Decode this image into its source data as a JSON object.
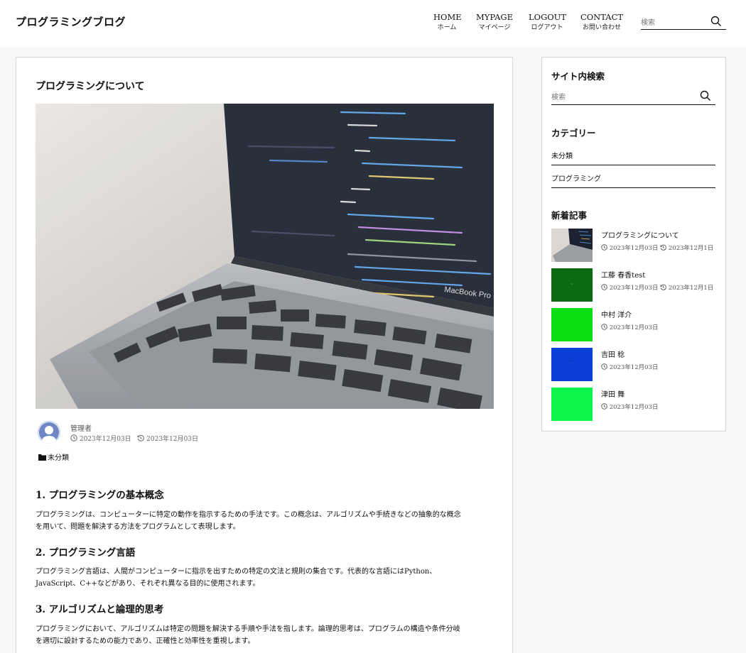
{
  "header": {
    "site_title": "プログラミングブログ",
    "nav": [
      {
        "en": "HOME",
        "jp": "ホーム"
      },
      {
        "en": "MYPAGE",
        "jp": "マイページ"
      },
      {
        "en": "LOGOUT",
        "jp": "ログアウト"
      },
      {
        "en": "CONTACT",
        "jp": "お問い合わせ"
      }
    ],
    "search_placeholder": "検索"
  },
  "post": {
    "title": "プログラミングについて",
    "hero_icon": "laptop-code-photo",
    "author": "管理者",
    "published": "2023年12月03日",
    "updated": "2023年12月03日",
    "category": "未分類",
    "sections": [
      {
        "heading": "1. プログラミングの基本概念",
        "lines": [
          "プログラミングは、コンピューターに特定の動作を指示するための手法です。この概念は、アルゴリズムや手続きなどの抽象的な概念",
          "を用いて、問題を解決する方法をプログラムとして表現します。"
        ]
      },
      {
        "heading": "2. プログラミング言語",
        "lines": [
          "プログラミング言語は、人間がコンピューターに指示を出すための特定の文法と規則の集合です。代表的な言語にはPython、",
          "JavaScript、C++などがあり、それぞれ異なる目的に使用されます。"
        ]
      },
      {
        "heading": "3. アルゴリズムと論理的思考",
        "lines": [
          "プログラミングにおいて、アルゴリズムは特定の問題を解決する手順や手法を指します。論理的思考は、プログラムの構造や条件分岐",
          "を適切に設計するための能力であり、正確性と効率性を重視します。"
        ]
      }
    ]
  },
  "sidebar": {
    "search_heading": "サイト内検索",
    "search_placeholder": "検索",
    "category_heading": "カテゴリー",
    "categories": [
      "未分類",
      "プログラミング"
    ],
    "recent_heading": "新着記事",
    "recent": [
      {
        "title": "プログラミングについて",
        "published": "2023年12月03日",
        "updated": "2023年12月1日",
        "color": "#9aa0a8"
      },
      {
        "title": "工藤 春香test",
        "published": "2023年12月03日",
        "updated": "2023年12月1日",
        "color": "#0a6b14"
      },
      {
        "title": "中村 洋介",
        "published": "2023年12月03日",
        "updated": "",
        "color": "#0add12"
      },
      {
        "title": "吉田 稔",
        "published": "2023年12月03日",
        "updated": "",
        "color": "#0a3fd6"
      },
      {
        "title": "津田 舞",
        "published": "2023年12月03日",
        "updated": "",
        "color": "#0bf54a"
      }
    ]
  },
  "colors": {
    "accent": "#111111",
    "border": "#d6d6d6",
    "background": "#f7f8f7"
  }
}
